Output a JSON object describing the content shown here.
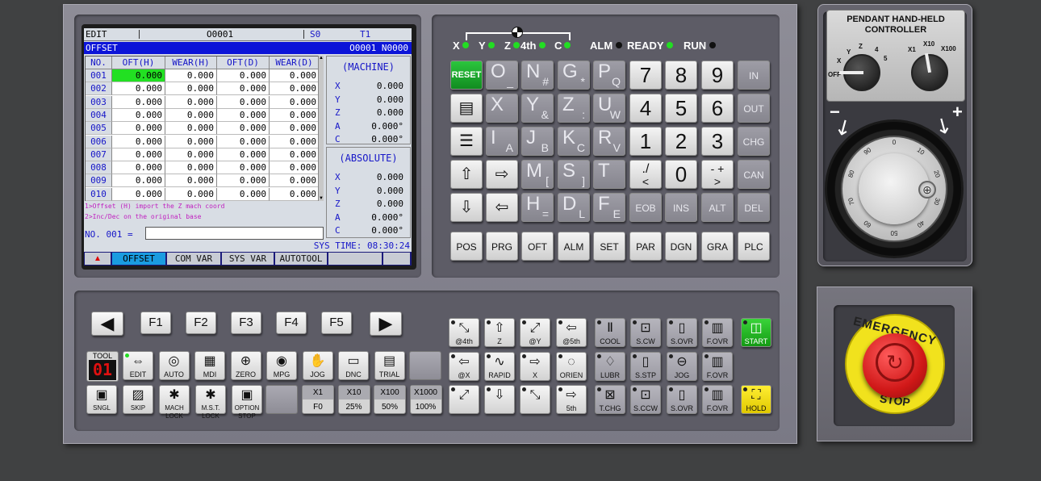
{
  "screen": {
    "mode": "EDIT",
    "program": "O0001",
    "spindle": "S0",
    "tool": "T1",
    "page": "OFFSET",
    "prog_seq": "O0001 N0000",
    "headers": [
      "NO.",
      "OFT(H)",
      "WEAR(H)",
      "OFT(D)",
      "WEAR(D)"
    ],
    "rows": [
      [
        "001",
        "0.000",
        "0.000",
        "0.000",
        "0.000"
      ],
      [
        "002",
        "0.000",
        "0.000",
        "0.000",
        "0.000"
      ],
      [
        "003",
        "0.000",
        "0.000",
        "0.000",
        "0.000"
      ],
      [
        "004",
        "0.000",
        "0.000",
        "0.000",
        "0.000"
      ],
      [
        "005",
        "0.000",
        "0.000",
        "0.000",
        "0.000"
      ],
      [
        "006",
        "0.000",
        "0.000",
        "0.000",
        "0.000"
      ],
      [
        "007",
        "0.000",
        "0.000",
        "0.000",
        "0.000"
      ],
      [
        "008",
        "0.000",
        "0.000",
        "0.000",
        "0.000"
      ],
      [
        "009",
        "0.000",
        "0.000",
        "0.000",
        "0.000"
      ],
      [
        "010",
        "0.000",
        "0.000",
        "0.000",
        "0.000"
      ]
    ],
    "machine_title": "(MACHINE)",
    "absolute_title": "(ABSOLUTE)",
    "machine": [
      [
        "X",
        "0.000"
      ],
      [
        "Y",
        "0.000"
      ],
      [
        "Z",
        "0.000"
      ],
      [
        "A",
        "0.000°"
      ],
      [
        "C",
        "0.000°"
      ]
    ],
    "absolute": [
      [
        "X",
        "0.000"
      ],
      [
        "Y",
        "0.000"
      ],
      [
        "Z",
        "0.000"
      ],
      [
        "A",
        "0.000°"
      ],
      [
        "C",
        "0.000°"
      ]
    ],
    "hint1": "1>Offset (H) import the Z mach coord",
    "hint2": "2>Inc/Dec on the original base",
    "input_label": "NO. 001 =",
    "input_value": "",
    "sys_time": "SYS TIME: 08:30:24",
    "softkeys": [
      "OFFSET",
      "COM VAR",
      "SYS VAR",
      "AUTOTOOL",
      "",
      ""
    ]
  },
  "indicators": {
    "axes": [
      "X",
      "Y",
      "Z",
      "4th",
      "C"
    ],
    "alm": "ALM",
    "ready": "READY",
    "run": "RUN"
  },
  "keys": {
    "reset": "RESET",
    "in": "IN",
    "out": "OUT",
    "chg": "CHG",
    "can": "CAN",
    "del": "DEL",
    "eob": "EOB",
    "ins": "INS",
    "alt": "ALT",
    "func": [
      "POS",
      "PRG",
      "OFT",
      "ALM",
      "SET",
      "PAR",
      "DGN",
      "GRA",
      "PLC"
    ],
    "addr": [
      [
        "O",
        "_"
      ],
      [
        "N",
        "#"
      ],
      [
        "G",
        "*"
      ],
      [
        "P",
        "Q"
      ],
      [
        "X",
        ""
      ],
      [
        "Y",
        "&"
      ],
      [
        "Z",
        ":"
      ],
      [
        "U",
        "W"
      ],
      [
        "I",
        "A"
      ],
      [
        "J",
        "B"
      ],
      [
        "K",
        "C"
      ],
      [
        "R",
        "V"
      ],
      [
        "M",
        "["
      ],
      [
        "S",
        "]"
      ],
      [
        "T",
        ""
      ],
      [
        "H",
        "="
      ],
      [
        "D",
        "L"
      ],
      [
        "F",
        "E"
      ]
    ],
    "digits": [
      "7",
      "8",
      "9",
      "4",
      "5",
      "6",
      "1",
      "2",
      "3",
      "0"
    ],
    "dot_main": "./",
    "dot_sub": "<",
    "sign_main": "- +",
    "sign_sub": ">"
  },
  "fkeys": [
    "F1",
    "F2",
    "F3",
    "F4",
    "F5"
  ],
  "mode_keys": {
    "tool_label": "TOOL",
    "tool_num": "01",
    "row1": [
      "EDIT",
      "AUTO",
      "MDI",
      "ZERO",
      "MPG",
      "JOG",
      "DNC",
      "TRIAL"
    ],
    "row2": [
      "SNGL",
      "SKIP",
      "MACH LOCK",
      "M.S.T. LOCK",
      "OPTION STOP"
    ],
    "mst": "MST",
    "dnc_tag": "DNC",
    "trial_tag": "Trial",
    "rate_top": [
      "X1",
      "X10",
      "X100",
      "X1000"
    ],
    "rate_bot": [
      "F0",
      "25%",
      "50%",
      "100%"
    ]
  },
  "axis_keys": {
    "r1": [
      "@4th",
      "Z",
      "@Y",
      "@5th",
      "COOL",
      "S.CW",
      "S.OVR",
      "F.OVR",
      "START"
    ],
    "r2": [
      "@X",
      "RAPID",
      "X",
      "ORIEN",
      "LUBR",
      "S.STP",
      "JOG",
      "F.OVR"
    ],
    "r3": [
      "",
      "",
      "",
      "5th",
      "T.CHG",
      "S.CCW",
      "S.OVR",
      "F.OVR",
      "HOLD"
    ],
    "tags": {
      "z_up": "Z",
      "y_up": "Y",
      "th5": "5th",
      "z_dn": "Z",
      "y_dn": "Y",
      "th4": "4th"
    },
    "pct_plus": "%+",
    "pct_100": "100%",
    "pct_minus": "%-"
  },
  "pendant": {
    "title1": "PENDANT HAND-HELD",
    "title2": "CONTROLLER",
    "axis_labels": [
      "OFF",
      "X",
      "Y",
      "Z",
      "4",
      "5"
    ],
    "rate_labels": [
      "X1",
      "X10",
      "X100"
    ],
    "minus": "−",
    "plus": "+",
    "dial": [
      "0",
      "10",
      "20",
      "30",
      "40",
      "50",
      "60",
      "70",
      "80",
      "90"
    ]
  },
  "estop": {
    "top": "EMERGENCY",
    "bottom": "STOP"
  }
}
